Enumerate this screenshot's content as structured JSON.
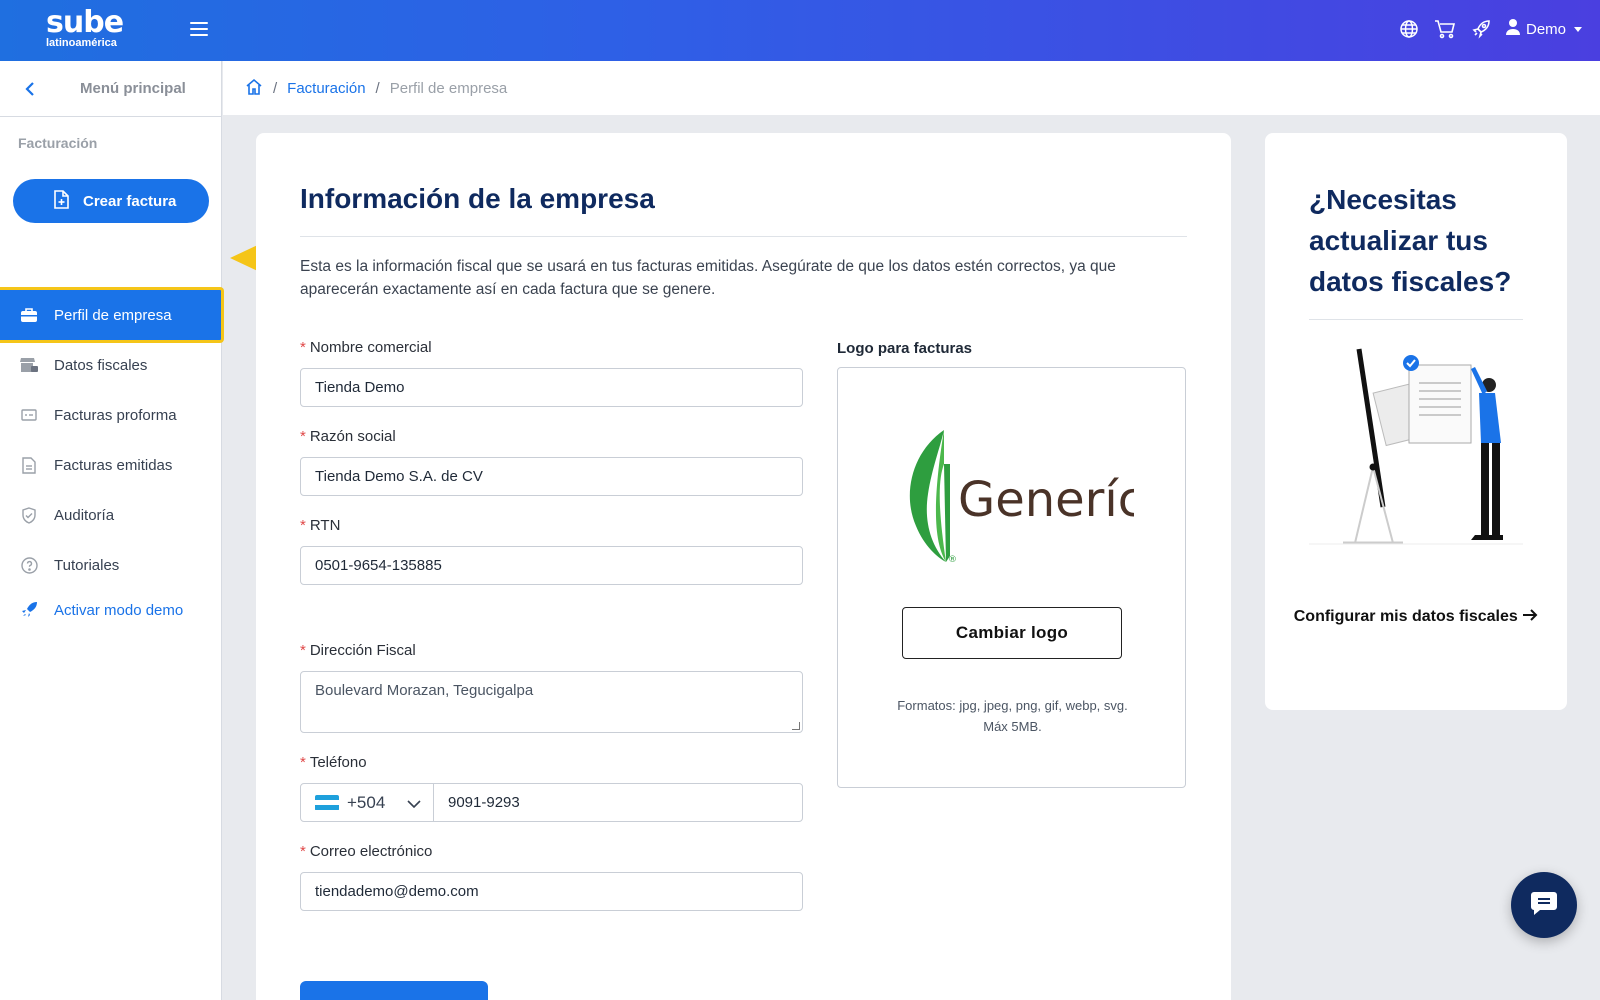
{
  "header": {
    "logo_main": "sube",
    "logo_sub": "latinoamérica",
    "user_label": "Demo",
    "icons": [
      "globe-icon",
      "cart-icon",
      "rocket-icon",
      "user-icon"
    ]
  },
  "sidebar": {
    "menu_title": "Menú principal",
    "section": "Facturación",
    "create_button": "Crear factura",
    "items": [
      {
        "label": "Perfil de empresa",
        "icon": "briefcase-icon",
        "active": true
      },
      {
        "label": "Datos fiscales",
        "icon": "store-lock-icon"
      },
      {
        "label": "Facturas proforma",
        "icon": "card-icon"
      },
      {
        "label": "Facturas emitidas",
        "icon": "document-icon"
      },
      {
        "label": "Auditoría",
        "icon": "shield-check-icon"
      },
      {
        "label": "Tutoriales",
        "icon": "help-circle-icon"
      }
    ],
    "demo_link": "Activar modo demo"
  },
  "breadcrumb": {
    "link": "Facturación",
    "current": "Perfil de empresa"
  },
  "main": {
    "title": "Información de la empresa",
    "intro": "Esta es la información fiscal que se usará en tus facturas emitidas. Asegúrate de que los datos estén correctos, ya que aparecerán exactamente así en cada factura que se genere.",
    "fields": {
      "nombre_label": "Nombre comercial",
      "nombre_value": "Tienda Demo",
      "razon_label": "Razón social",
      "razon_value": "Tienda Demo S.A. de CV",
      "rtn_label": "RTN",
      "rtn_value": "0501-9654-135885",
      "direccion_label": "Dirección Fiscal",
      "direccion_value": "Boulevard Morazan, Tegucigalpa",
      "telefono_label": "Teléfono",
      "telefono_prefix": "+504",
      "telefono_value": "9091-9293",
      "correo_label": "Correo electrónico",
      "correo_value": "tiendademo@demo.com"
    },
    "logo": {
      "label": "Logo para facturas",
      "brand_text": "Generíc",
      "registered": "®",
      "change_button": "Cambiar logo",
      "formats_line1": "Formatos: jpg, jpeg, png, gif, webp, svg.",
      "formats_line2": "Máx 5MB."
    }
  },
  "aside": {
    "title": "¿Necesitas actualizar tus datos fiscales?",
    "link": "Configurar mis datos fiscales"
  },
  "colors": {
    "primary": "#1a73e8",
    "navy": "#0f2a5f",
    "highlight": "#f5c518"
  }
}
